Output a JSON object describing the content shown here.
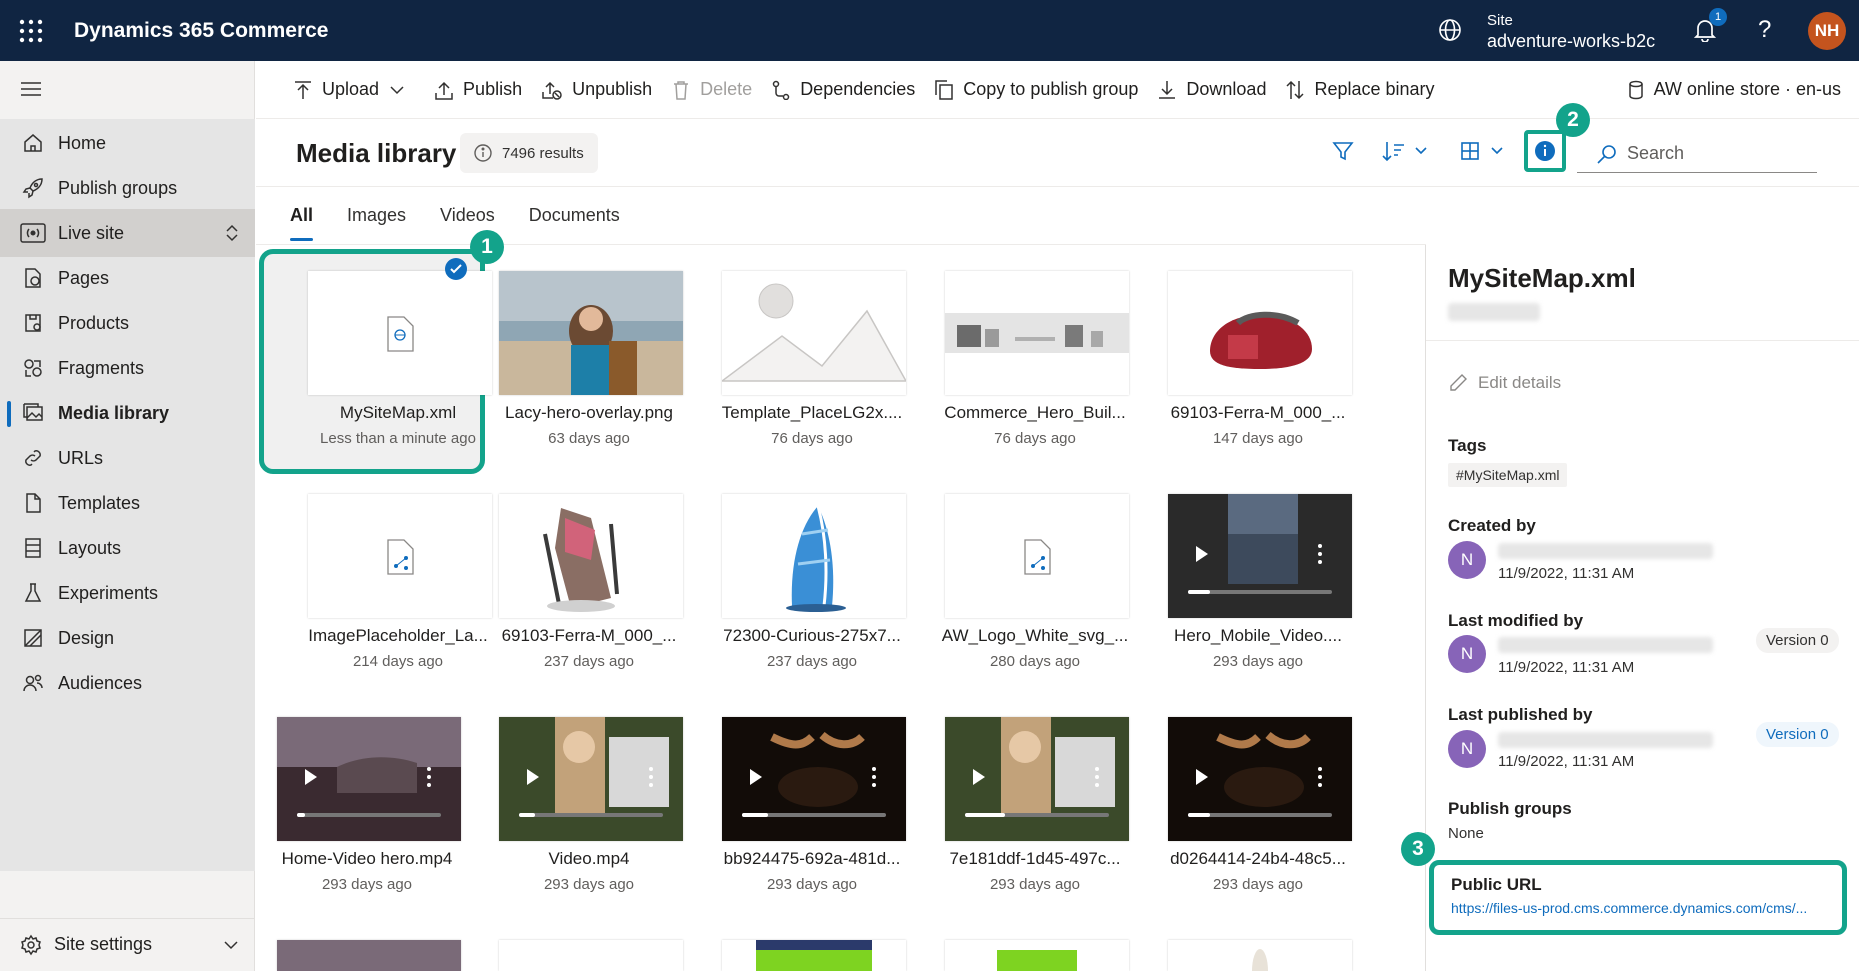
{
  "topbar": {
    "app_title": "Dynamics 365 Commerce",
    "site_label": "Site",
    "site_value": "adventure-works-b2c",
    "notification_count": "1",
    "help": "?",
    "user_initials": "NH"
  },
  "sidebar": {
    "items": [
      {
        "label": "Home"
      },
      {
        "label": "Publish groups"
      },
      {
        "label": "Live site"
      },
      {
        "label": "Pages"
      },
      {
        "label": "Products"
      },
      {
        "label": "Fragments"
      },
      {
        "label": "Media library"
      },
      {
        "label": "URLs"
      },
      {
        "label": "Templates"
      },
      {
        "label": "Layouts"
      },
      {
        "label": "Experiments"
      },
      {
        "label": "Design"
      },
      {
        "label": "Audiences"
      }
    ],
    "settings_label": "Site settings"
  },
  "commandbar": {
    "upload": "Upload",
    "publish": "Publish",
    "unpublish": "Unpublish",
    "delete": "Delete",
    "dependencies": "Dependencies",
    "copy": "Copy to publish group",
    "download": "Download",
    "replace": "Replace binary",
    "store": "AW online store · en-us"
  },
  "page": {
    "title": "Media library",
    "results": "7496 results",
    "search_placeholder": "Search"
  },
  "tabs": [
    "All",
    "Images",
    "Videos",
    "Documents"
  ],
  "callouts": [
    "1",
    "2",
    "3"
  ],
  "media": [
    {
      "name": "MySiteMap.xml",
      "date": "Less than a minute ago"
    },
    {
      "name": "Lacy-hero-overlay.png",
      "date": "63 days ago"
    },
    {
      "name": "Template_PlaceLG2x....",
      "date": "76 days ago"
    },
    {
      "name": "Commerce_Hero_Buil...",
      "date": "76 days ago"
    },
    {
      "name": "69103-Ferra-M_000_...",
      "date": "147 days ago"
    },
    {
      "name": "ImagePlaceholder_La...",
      "date": "214 days ago"
    },
    {
      "name": "69103-Ferra-M_000_...",
      "date": "237 days ago"
    },
    {
      "name": "72300-Curious-275x7...",
      "date": "237 days ago"
    },
    {
      "name": "AW_Logo_White_svg_...",
      "date": "280 days ago"
    },
    {
      "name": "Hero_Mobile_Video....",
      "date": "293 days ago"
    },
    {
      "name": "Home-Video hero.mp4",
      "date": "293 days ago"
    },
    {
      "name": "Video.mp4",
      "date": "293 days ago"
    },
    {
      "name": "bb924475-692a-481d...",
      "date": "293 days ago"
    },
    {
      "name": "7e181ddf-1d45-497c...",
      "date": "293 days ago"
    },
    {
      "name": "d0264414-24b4-48c5...",
      "date": "293 days ago"
    }
  ],
  "details": {
    "title": "MySiteMap.xml",
    "edit_details": "Edit details",
    "tags_label": "Tags",
    "tag": "#MySiteMap.xml",
    "created_by": "Created by",
    "created_date": "11/9/2022, 11:31 AM",
    "modified_by": "Last modified by",
    "modified_date": "11/9/2022, 11:31 AM",
    "modified_version": "Version 0",
    "published_by": "Last published by",
    "published_date": "11/9/2022, 11:31 AM",
    "published_version": "Version 0",
    "avatar_initial": "N",
    "publish_groups_label": "Publish groups",
    "publish_groups_value": "None",
    "public_url_label": "Public URL",
    "public_url": "https://files-us-prod.cms.commerce.dynamics.com/cms/..."
  },
  "colors": {
    "accent": "#0f6cbd",
    "callout": "#13a38b",
    "topbar": "#102542"
  }
}
